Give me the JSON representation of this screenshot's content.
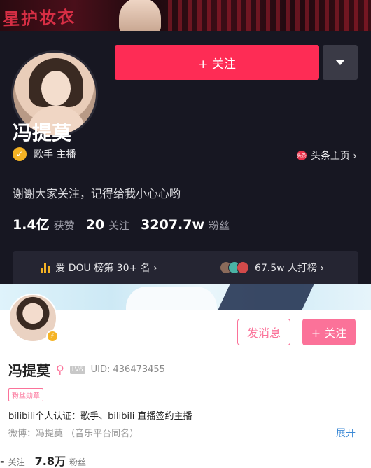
{
  "douyin": {
    "banner_text": "星护妆衣",
    "follow_label": "+ 关注",
    "name": "冯提莫",
    "verify_text": "歌手 主播",
    "toutiao_badge": "头条",
    "toutiao_label": "头条主页 ›",
    "bio": "谢谢大家关注，记得给我小心心哟",
    "stats": [
      {
        "num": "1.4亿",
        "label": "获赞"
      },
      {
        "num": "20",
        "label": "关注"
      },
      {
        "num": "3207.7w",
        "label": "粉丝"
      }
    ],
    "rank_label": "爱 DOU 榜第 30+ 名 ›",
    "fans_label": "67.5w 人打榜 ›",
    "colors": {
      "accent": "#fe2c55",
      "bg": "#171722",
      "gold": "#f5b324"
    }
  },
  "bilibili": {
    "message_label": "发消息",
    "follow_label": "+ 关注",
    "name": "冯提莫",
    "gender_icon": "♀",
    "level": "LV6",
    "uid": "UID:  436473455",
    "medal": "粉丝勋章",
    "certification": "bilibili个人认证：歌手、bilibili 直播签约主播",
    "weibo": "微博：冯提莫  （音乐平台同名）",
    "expand_label": "展开",
    "stats": [
      {
        "num": "-",
        "label": "关注"
      },
      {
        "num": "7.8万",
        "label": "粉丝"
      }
    ],
    "colors": {
      "accent": "#fb7299",
      "link": "#3d8ad6"
    }
  }
}
